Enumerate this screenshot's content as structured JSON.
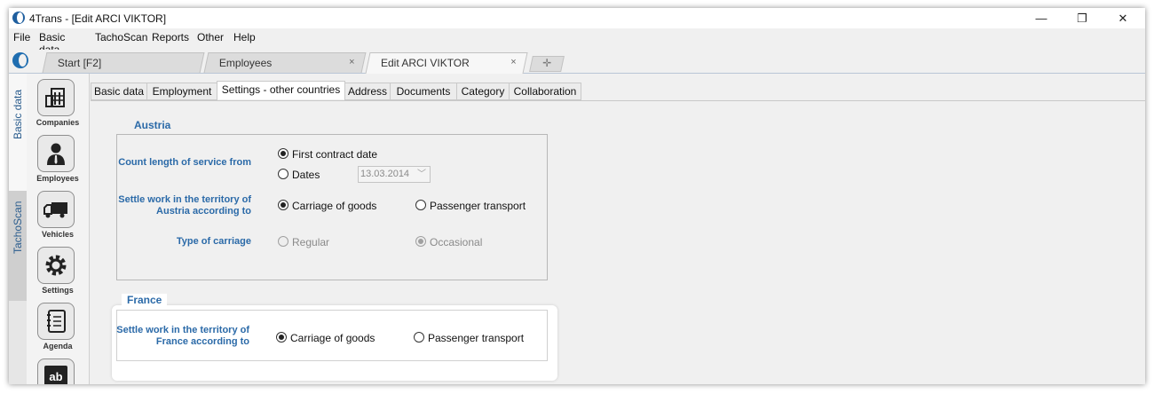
{
  "window": {
    "title": "4Trans - [Edit ARCI VIKTOR]",
    "minimize": "—",
    "restore": "❐",
    "close": "✕"
  },
  "menu": [
    "File",
    "Basic data",
    "TachoScan",
    "Reports",
    "Other",
    "Help"
  ],
  "doc_tabs": [
    {
      "label": "Start [F2]",
      "closable": false
    },
    {
      "label": "Employees",
      "close": "×"
    },
    {
      "label": "Edit ARCI VIKTOR",
      "close": "×"
    }
  ],
  "add_tab": "✛",
  "side_sections": [
    "Basic data",
    "TachoScan"
  ],
  "nav": [
    {
      "label": "Companies",
      "icon": "building-icon"
    },
    {
      "label": "Employees",
      "icon": "person-icon"
    },
    {
      "label": "Vehicles",
      "icon": "truck-icon"
    },
    {
      "label": "Settings",
      "icon": "gear-icon"
    },
    {
      "label": "Agenda",
      "icon": "notebook-icon"
    },
    {
      "label": "ab",
      "icon": "dictionary-icon"
    }
  ],
  "sub_tabs": [
    "Basic data",
    "Employment",
    "Settings - other countries",
    "Address",
    "Documents",
    "Category",
    "Collaboration"
  ],
  "austria": {
    "title": "Austria",
    "service_label": "Count length of service from",
    "opt_first_contract": "First contract date",
    "opt_dates": "Dates",
    "date_value": "13.03.2014",
    "settle_label": "Settle work in the territory of Austria according to",
    "opt_goods": "Carriage of goods",
    "opt_passenger": "Passenger transport",
    "type_label": "Type of carriage",
    "opt_regular": "Regular",
    "opt_occasional": "Occasional"
  },
  "france": {
    "title": "France",
    "settle_label": "Settle work in the territory of France according to",
    "opt_goods": "Carriage of goods",
    "opt_passenger": "Passenger transport"
  }
}
